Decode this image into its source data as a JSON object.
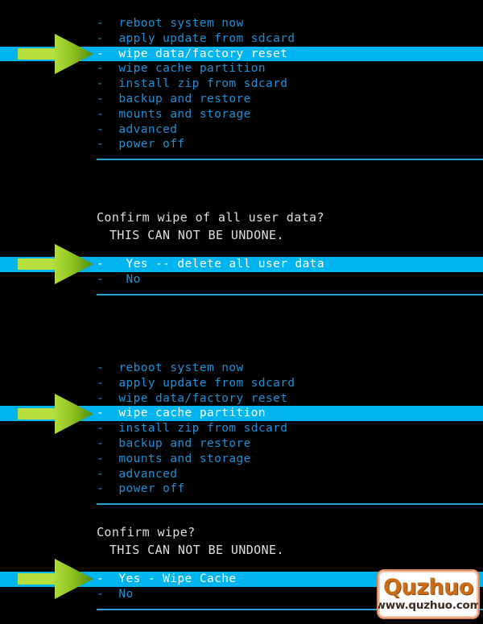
{
  "colors": {
    "background": "#000000",
    "menu_text": "#1f90d6",
    "highlight_bg": "#00b4f0",
    "highlight_text": "#ffffff",
    "header_text": "#dfdfdf",
    "divider": "#2a9fd8",
    "arrow_light": "#b7e03f",
    "arrow_dark": "#4f8c10",
    "watermark_title": "#cc6c18",
    "watermark_url": "#3a2b24"
  },
  "panels": [
    {
      "id": "recovery-main-menu-1",
      "headers": [],
      "items": [
        {
          "label": "-  reboot system now",
          "selected": false
        },
        {
          "label": "-  apply update from sdcard",
          "selected": false
        },
        {
          "label": "-  wipe data/factory reset",
          "selected": true
        },
        {
          "label": "-  wipe cache partition",
          "selected": false
        },
        {
          "label": "-  install zip from sdcard",
          "selected": false
        },
        {
          "label": "-  backup and restore",
          "selected": false
        },
        {
          "label": "-  mounts and storage",
          "selected": false
        },
        {
          "label": "-  advanced",
          "selected": false
        },
        {
          "label": "-  power off",
          "selected": false
        }
      ],
      "arrow_target_index": 2
    },
    {
      "id": "confirm-wipe-data-2",
      "headers": [
        {
          "text": "Confirm wipe of all user data?",
          "indented": false
        },
        {
          "text": "THIS CAN NOT BE UNDONE.",
          "indented": true
        }
      ],
      "items": [
        {
          "label": "-   Yes -- delete all user data",
          "selected": true
        },
        {
          "label": "-   No",
          "selected": false
        }
      ],
      "arrow_target_index": 0
    },
    {
      "id": "recovery-main-menu-3",
      "headers": [],
      "items": [
        {
          "label": "-  reboot system now",
          "selected": false
        },
        {
          "label": "-  apply update from sdcard",
          "selected": false
        },
        {
          "label": "-  wipe data/factory reset",
          "selected": false
        },
        {
          "label": "-  wipe cache partition",
          "selected": true
        },
        {
          "label": "-  install zip from sdcard",
          "selected": false
        },
        {
          "label": "-  backup and restore",
          "selected": false
        },
        {
          "label": "-  mounts and storage",
          "selected": false
        },
        {
          "label": "-  advanced",
          "selected": false
        },
        {
          "label": "-  power off",
          "selected": false
        }
      ],
      "arrow_target_index": 3
    },
    {
      "id": "confirm-wipe-cache-4",
      "headers": [
        {
          "text": "Confirm wipe?",
          "indented": false
        },
        {
          "text": "THIS CAN NOT BE UNDONE.",
          "indented": true
        }
      ],
      "items": [
        {
          "label": "-  Yes - Wipe Cache",
          "selected": true
        },
        {
          "label": "-  No",
          "selected": false
        }
      ],
      "arrow_target_index": 0
    }
  ],
  "watermark": {
    "title": "Quzhuo",
    "url": "www.quzhuo.com"
  }
}
